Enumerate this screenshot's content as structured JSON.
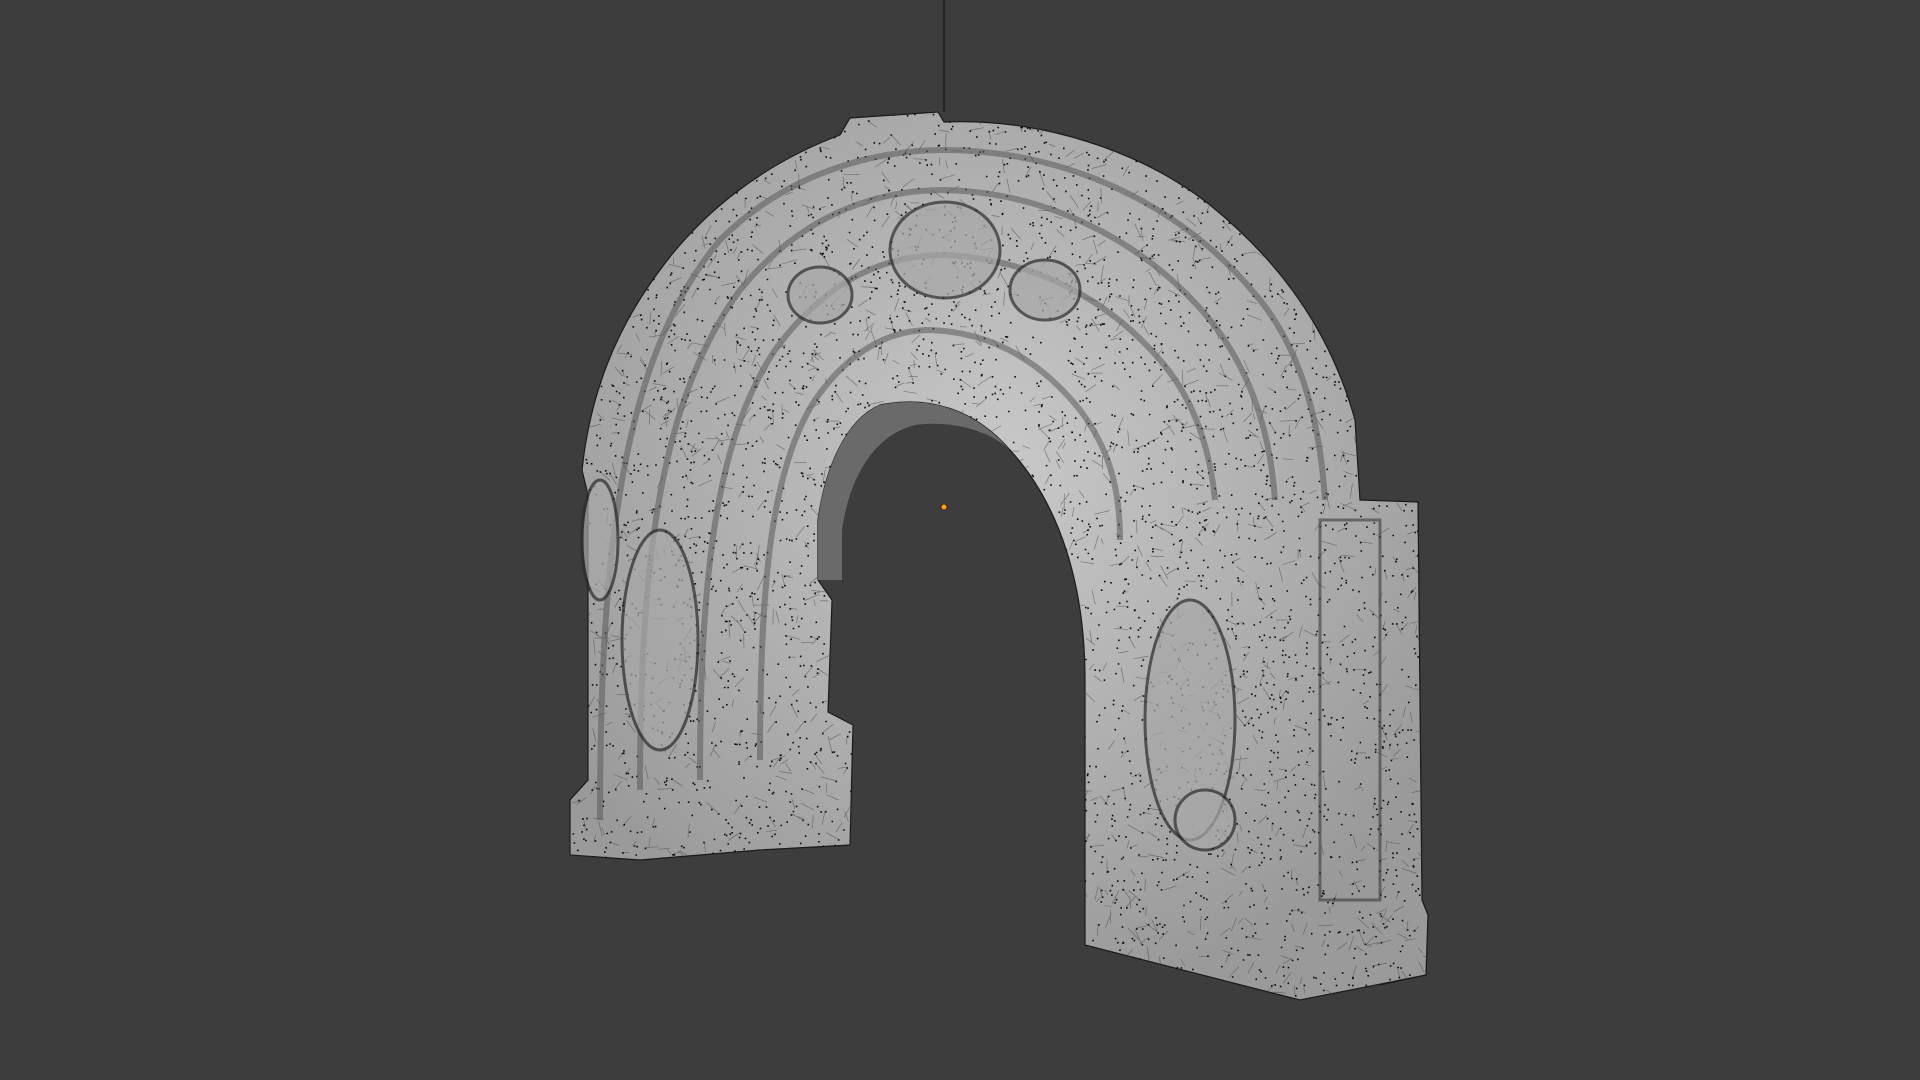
{
  "viewport": {
    "background_color": "#3d3d3d",
    "object": {
      "description_icon": "stone-arch-mesh-icon",
      "surface_color": "#b8b8b8",
      "wire_color": "#0a0a0a",
      "edge_color": "#4a4a4a"
    },
    "origin_marker_color": "#ff9a1a",
    "guide_line_color": "#1e1e1e"
  }
}
